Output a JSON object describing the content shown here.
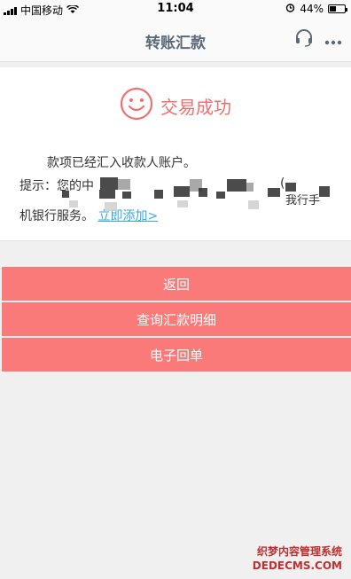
{
  "status_bar": {
    "carrier": "中国移动",
    "time": "11:04",
    "battery_text": "44%",
    "battery_level": 0.44
  },
  "nav": {
    "title": "转账汇款",
    "icons": [
      "headset-icon",
      "more-icon"
    ]
  },
  "result": {
    "status": "交易成功",
    "message": "款项已经汇入收款人账户。",
    "tip_prefix": "提示：您的中",
    "tip_fragment_mid": "(",
    "tip_fragment_right": "我行手",
    "tip_line3": "机银行服务。",
    "add_link": "立即添加>"
  },
  "buttons": {
    "back": "返回",
    "query": "查询汇款明细",
    "receipt": "电子回单"
  },
  "watermark": {
    "line1": "织梦内容管理系统",
    "line2": "DEDECMS.COM"
  },
  "colors": {
    "accent": "#fa7a7a",
    "success": "#f07070",
    "link": "#3aa8e0"
  }
}
